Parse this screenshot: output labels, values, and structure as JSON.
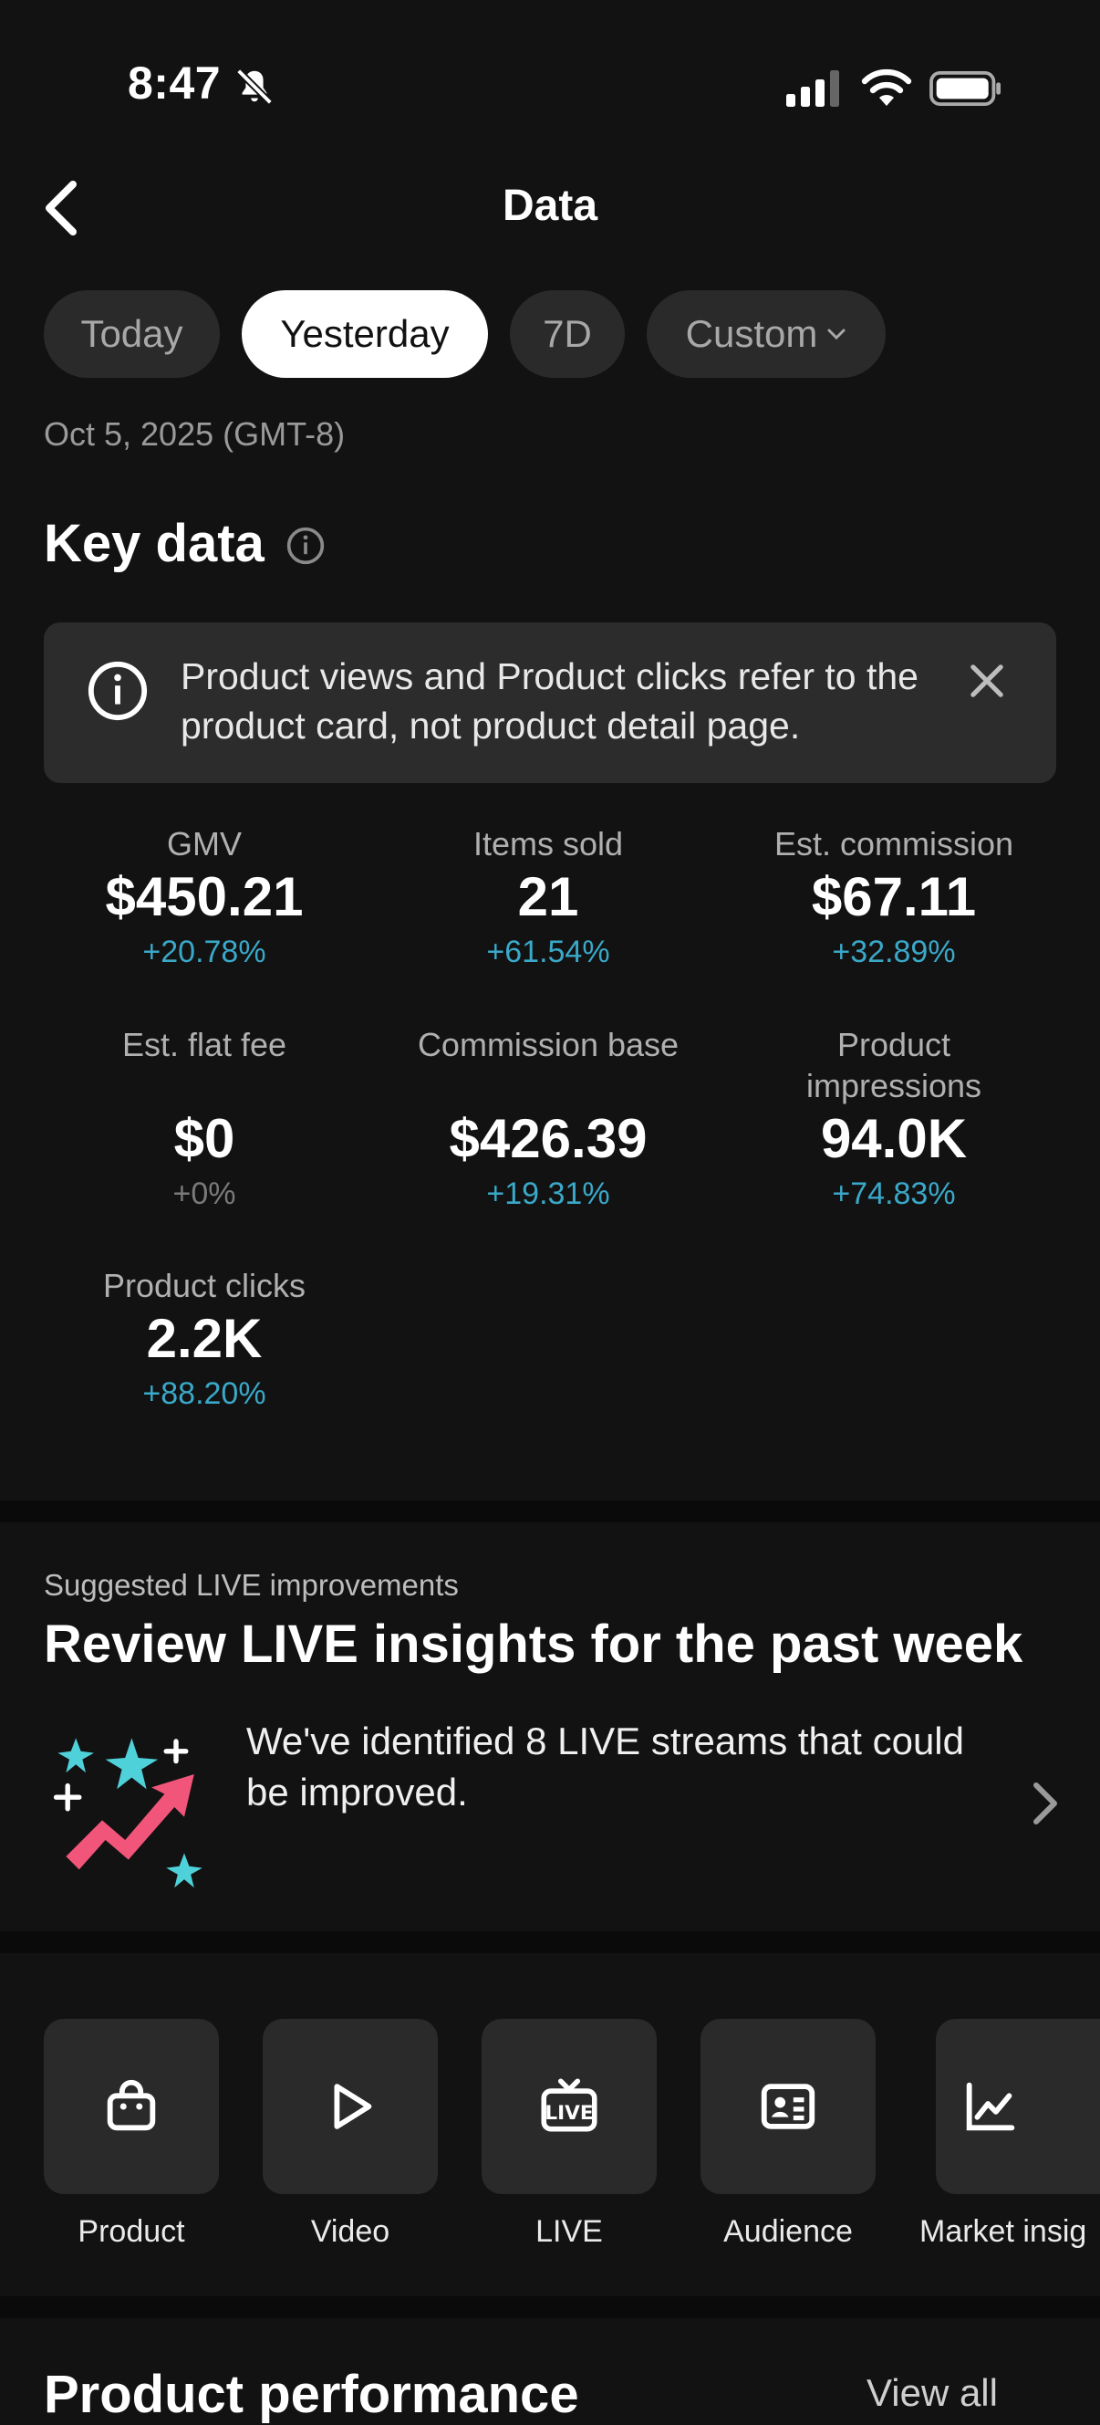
{
  "status": {
    "time": "8:47"
  },
  "header": {
    "title": "Data"
  },
  "filters": [
    {
      "label": "Today",
      "active": false
    },
    {
      "label": "Yesterday",
      "active": true
    },
    {
      "label": "7D",
      "active": false
    },
    {
      "label": "Custom",
      "active": false
    }
  ],
  "date_range": "Oct 5, 2025 (GMT-8)",
  "key_data": {
    "title": "Key data",
    "banner_text": "Product views and Product clicks refer to the product card, not product detail page.",
    "metrics": [
      {
        "label": "GMV",
        "value": "$450.21",
        "change": "+20.78%"
      },
      {
        "label": "Items sold",
        "value": "21",
        "change": "+61.54%"
      },
      {
        "label": "Est. commission",
        "value": "$67.11",
        "change": "+32.89%"
      },
      {
        "label": "Est. flat fee",
        "value": "$0",
        "change": "+0%"
      },
      {
        "label": "Commission base",
        "value": "$426.39",
        "change": "+19.31%"
      },
      {
        "label": "Product impressions",
        "value": "94.0K",
        "change": "+74.83%"
      },
      {
        "label": "Product clicks",
        "value": "2.2K",
        "change": "+88.20%"
      }
    ]
  },
  "suggestion": {
    "kicker": "Suggested LIVE improvements",
    "title": "Review LIVE insights for the past week",
    "text": "We've identified 8 LIVE streams that could be improved."
  },
  "tools": [
    {
      "label": "Product",
      "icon": "shopping-bag-icon"
    },
    {
      "label": "Video",
      "icon": "play-icon"
    },
    {
      "label": "LIVE",
      "icon": "live-tv-icon"
    },
    {
      "label": "Audience",
      "icon": "id-card-icon"
    },
    {
      "label": "Market insig",
      "icon": "line-chart-icon"
    }
  ],
  "product_performance": {
    "title": "Product performance",
    "view_all": "View all"
  },
  "colors": {
    "background": "#121212",
    "accent_positive": "#3aa8c8",
    "chip_bg": "#2a2a2a"
  }
}
